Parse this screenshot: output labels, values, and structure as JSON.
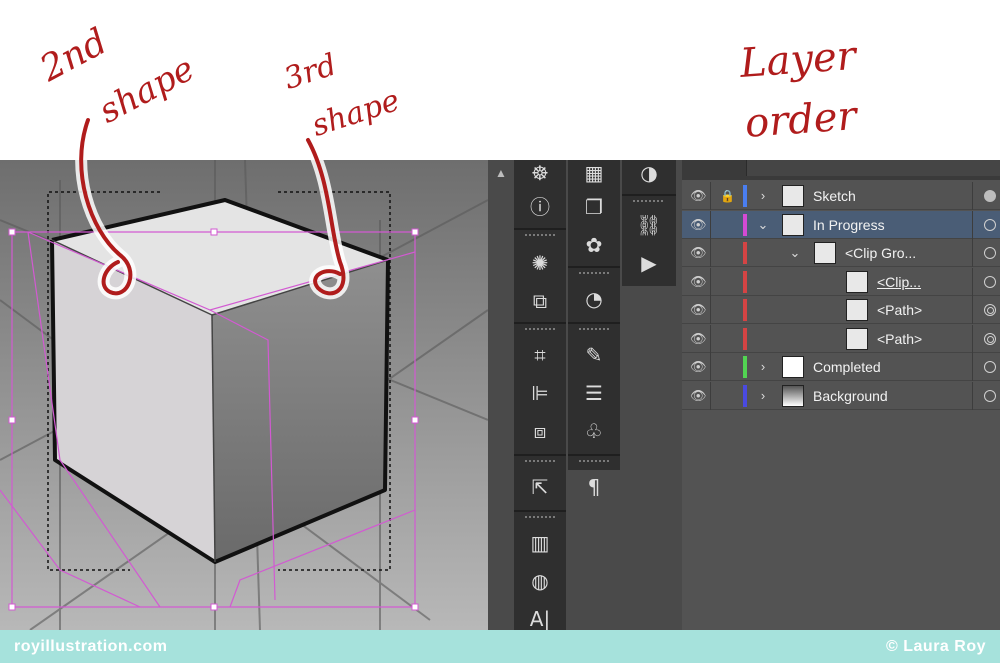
{
  "annotations": {
    "second_shape_line1": "2nd",
    "second_shape_line2": "shape",
    "third_shape_line1": "3rd",
    "third_shape_line2": "shape",
    "layer_order_line1": "Layer",
    "layer_order_line2": "order",
    "ink_color": "#b01c1c"
  },
  "tools": {
    "column1": [
      "wheel-icon",
      "info-icon",
      "sun-icon",
      "transform-icon",
      "artboard-icon",
      "align-icon",
      "pathfinder-icon",
      "export-icon",
      "gradient-icon",
      "transparency-icon",
      "character-icon"
    ],
    "column2": [
      "swatches-icon",
      "libraries-icon",
      "palette-icon",
      "stroke-icon",
      "brushes-icon",
      "lines-icon",
      "club-icon",
      "paragraph-icon"
    ],
    "column3": [
      "appearance-icon",
      "links-icon",
      "actions-icon"
    ]
  },
  "layers": {
    "items": [
      {
        "name": "Sketch",
        "color": "#4a7ef0",
        "depth": 0,
        "expanded": false,
        "locked": true,
        "selected": false,
        "target": "filled"
      },
      {
        "name": "In Progress",
        "color": "#d44ad4",
        "depth": 0,
        "expanded": true,
        "locked": false,
        "selected": true,
        "target": "empty"
      },
      {
        "name": "<Clip Gro...",
        "color": "#d44444",
        "depth": 1,
        "expanded": true,
        "locked": false,
        "selected": false,
        "target": "empty"
      },
      {
        "name": "<Clip...",
        "color": "#d44444",
        "depth": 2,
        "expanded": false,
        "locked": false,
        "selected": false,
        "target": "empty"
      },
      {
        "name": "<Path>",
        "color": "#d44444",
        "depth": 2,
        "expanded": false,
        "locked": false,
        "selected": false,
        "target": "double"
      },
      {
        "name": "<Path>",
        "color": "#d44444",
        "depth": 2,
        "expanded": false,
        "locked": false,
        "selected": false,
        "target": "double"
      },
      {
        "name": "Completed",
        "color": "#52d452",
        "depth": 0,
        "expanded": false,
        "locked": false,
        "selected": false,
        "target": "empty"
      },
      {
        "name": "Background",
        "color": "#4a4ae0",
        "depth": 0,
        "expanded": false,
        "locked": false,
        "selected": false,
        "target": "empty"
      }
    ]
  },
  "footer": {
    "left": "royillustration.com",
    "right": "© Laura Roy"
  }
}
